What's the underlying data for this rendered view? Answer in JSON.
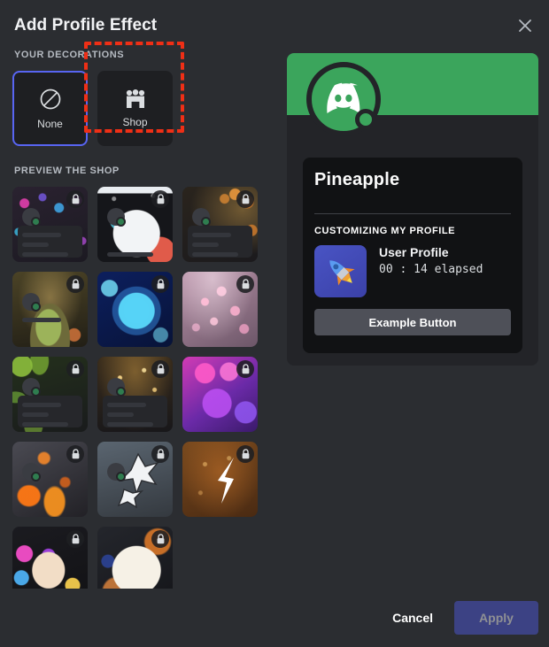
{
  "header": {
    "title": "Add Profile Effect",
    "close_icon": "close-icon"
  },
  "decorations": {
    "section_label": "YOUR DECORATIONS",
    "items": [
      {
        "label": "None",
        "icon": "no-entry-icon",
        "selected": true
      },
      {
        "label": "Shop",
        "icon": "storefront-icon",
        "selected": false,
        "annotated": true
      }
    ]
  },
  "shop": {
    "section_label": "PREVIEW THE SHOP",
    "lock_icon": "lock-icon",
    "tiles": [
      {
        "name": "holiday-lights",
        "locked": true
      },
      {
        "name": "snowman",
        "locked": true
      },
      {
        "name": "autumn-leaves",
        "locked": true
      },
      {
        "name": "frog-pond",
        "locked": true
      },
      {
        "name": "blue-wave",
        "locked": true
      },
      {
        "name": "cherry-blossom",
        "locked": true
      },
      {
        "name": "green-vines",
        "locked": true
      },
      {
        "name": "golden-sparkle",
        "locked": true
      },
      {
        "name": "neon-hearts",
        "locked": true
      },
      {
        "name": "lava-cracks",
        "locked": true
      },
      {
        "name": "ninja-shuriken",
        "locked": true
      },
      {
        "name": "lightning-bolt",
        "locked": true
      },
      {
        "name": "candy-rings",
        "locked": true
      },
      {
        "name": "jam-toast",
        "locked": true
      }
    ]
  },
  "preview": {
    "banner_color": "#3ba55c",
    "avatar_icon": "discord-logo-icon",
    "status": "online",
    "username": "Pineapple",
    "activity_label": "CUSTOMIZING MY PROFILE",
    "activity": {
      "icon": "rocket-pencil-icon",
      "name": "User Profile",
      "elapsed": "00 : 14 elapsed"
    },
    "example_button": "Example Button"
  },
  "footer": {
    "cancel_label": "Cancel",
    "apply_label": "Apply",
    "apply_color": "#3c4284",
    "apply_disabled": true
  }
}
